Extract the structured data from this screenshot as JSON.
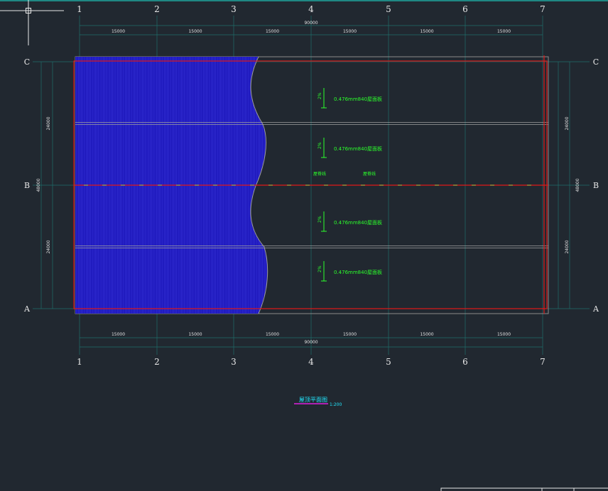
{
  "drawing": {
    "column_axes": [
      "1",
      "2",
      "3",
      "4",
      "5",
      "6",
      "7"
    ],
    "row_axes": [
      "C",
      "B",
      "A"
    ],
    "bay_dimensions": [
      "15000",
      "15000",
      "15000",
      "15000",
      "15000",
      "15000"
    ],
    "total_length": "90000",
    "span_dimensions": [
      "24000",
      "24000"
    ],
    "total_width": "48000",
    "roof_panel_notes": [
      "0.476mm840屋面板",
      "0.476mm840屋面板",
      "0.476mm840屋面板",
      "0.476mm840屋面板"
    ],
    "slope_labels": [
      "2%",
      "2%",
      "2%",
      "2%"
    ],
    "ridge_labels": [
      "屋脊线",
      "屋脊线"
    ],
    "title": "屋顶平面图",
    "scale": "1:200"
  },
  "colors": {
    "background": "#212830",
    "grid": "#1f6e6a",
    "outline_red": "#e01818",
    "panel_fill": "#1a14b8",
    "panel_lines": "#5b5bff",
    "note_green": "#2bff2b",
    "title_cyan": "#22e8ff"
  }
}
